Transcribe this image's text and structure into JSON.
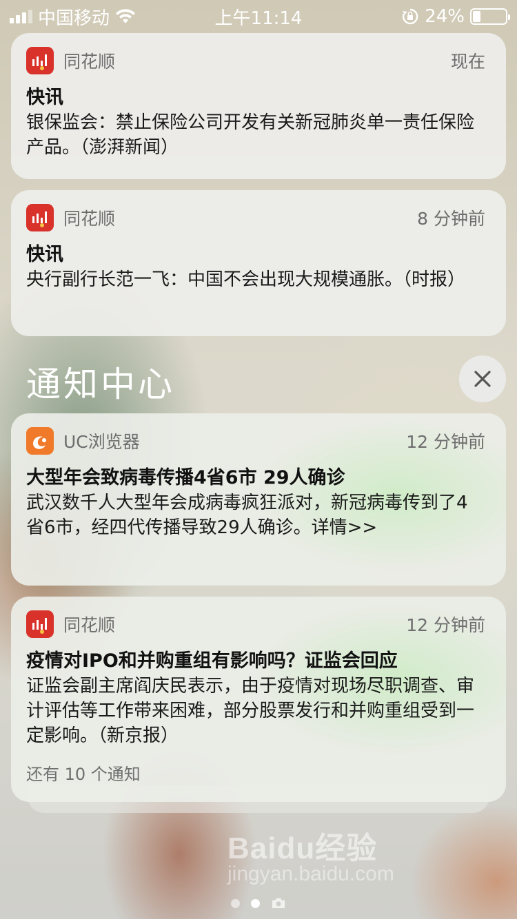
{
  "status_bar": {
    "carrier": "中国移动",
    "time": "上午11:14",
    "battery_percent": "24%",
    "battery_level": 0.24
  },
  "notifications_top": [
    {
      "app": "同花顺",
      "time": "现在",
      "title": "快讯",
      "body": "银保监会：禁止保险公司开发有关新冠肺炎单一责任保险产品。（澎湃新闻）"
    },
    {
      "app": "同花顺",
      "time": "8 分钟前",
      "title": "快讯",
      "body": "央行副行长范一飞：中国不会出现大规模通胀。（时报）"
    }
  ],
  "notification_center": {
    "title": "通知中心"
  },
  "notifications_center": [
    {
      "app": "UC浏览器",
      "time": "12 分钟前",
      "title": "大型年会致病毒传播4省6市 29人确诊",
      "body": "武汉数千人大型年会成病毒疯狂派对，新冠病毒传到了4省6市，经四代传播导致29人确诊。详情>>"
    },
    {
      "app": "同花顺",
      "time": "12 分钟前",
      "title": "疫情对IPO和并购重组有影响吗？证监会回应",
      "body": "证监会副主席阎庆民表示，由于疫情对现场尽职调查、审计评估等工作带来困难，部分股票发行和并购重组受到一定影响。（新京报）",
      "more": "还有 10 个通知"
    }
  ],
  "watermark": {
    "main": "Baidu经验",
    "sub": "jingyan.baidu.com"
  },
  "page_indicator": {
    "pages": 2,
    "active": 2
  }
}
